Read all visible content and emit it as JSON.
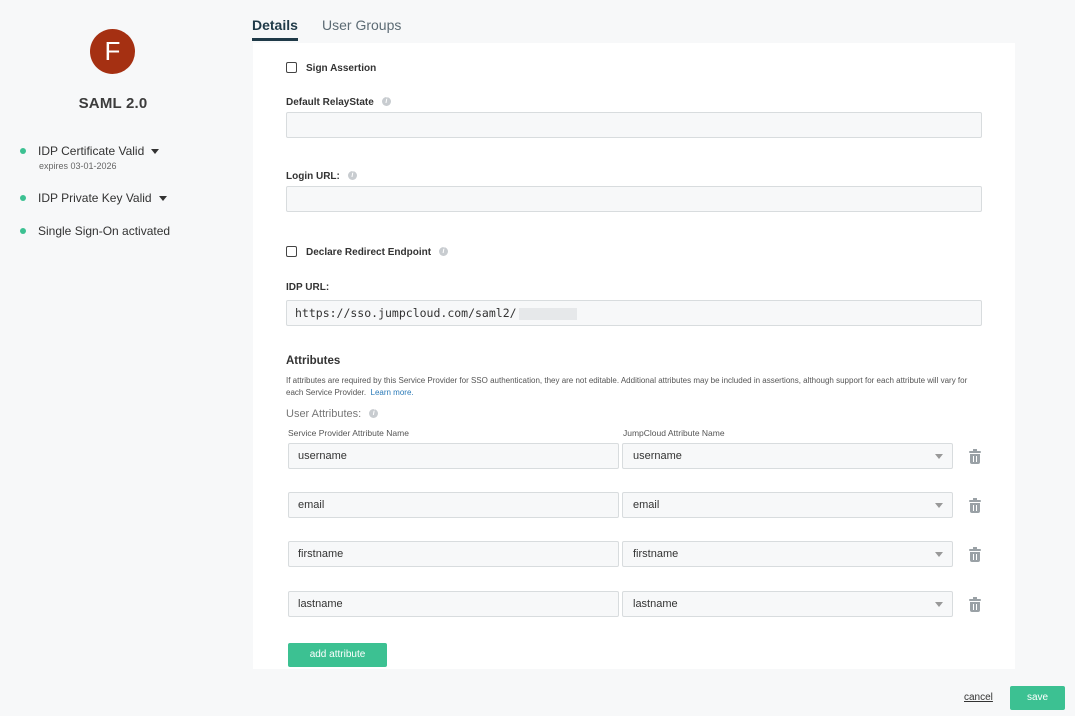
{
  "sidebar": {
    "avatar_letter": "F",
    "avatar_color": "#a53012",
    "app_title": "SAML 2.0",
    "status_items": [
      {
        "label": "IDP Certificate Valid",
        "sub": "expires 03-01-2026",
        "has_dropdown": true
      },
      {
        "label": "IDP Private Key Valid",
        "has_dropdown": true
      },
      {
        "label": "Single Sign-On activated",
        "has_dropdown": false
      }
    ],
    "status_color": "#3cc192"
  },
  "tabs": [
    {
      "label": "Details",
      "active": true
    },
    {
      "label": "User Groups",
      "active": false
    }
  ],
  "form": {
    "sign_assertion_label": "Sign Assertion",
    "sign_assertion_checked": false,
    "relay_state_label": "Default RelayState",
    "relay_state_value": "",
    "login_url_label": "Login URL:",
    "login_url_value": "",
    "declare_redirect_label": "Declare Redirect Endpoint",
    "declare_redirect_checked": false,
    "idp_url_label": "IDP URL:",
    "idp_url_value": "https://sso.jumpcloud.com/saml2/"
  },
  "attributes": {
    "title": "Attributes",
    "description": "If attributes are required by this Service Provider for SSO authentication, they are not editable. Additional attributes may be included in assertions, although support for each attribute will vary for each Service Provider.",
    "learn_more": "Learn more.",
    "user_attributes_label": "User Attributes:",
    "col_sp": "Service Provider Attribute Name",
    "col_jc": "JumpCloud Attribute Name",
    "rows": [
      {
        "sp": "username",
        "jc": "username"
      },
      {
        "sp": "email",
        "jc": "email"
      },
      {
        "sp": "firstname",
        "jc": "firstname"
      },
      {
        "sp": "lastname",
        "jc": "lastname"
      }
    ],
    "add_label": "add attribute"
  },
  "footer": {
    "cancel_label": "cancel",
    "save_label": "save"
  },
  "accent_color": "#3cc192"
}
